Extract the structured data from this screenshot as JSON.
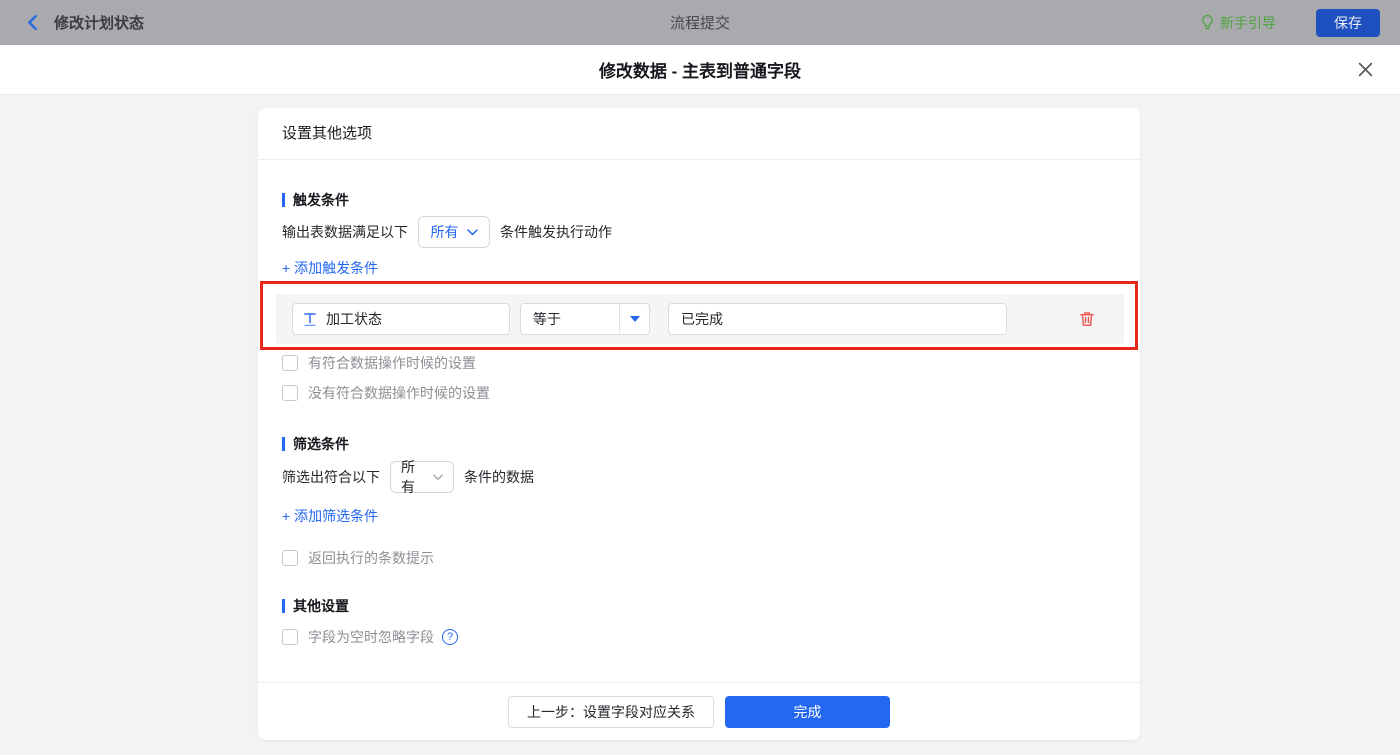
{
  "colors": {
    "accent_blue": "#2468f2",
    "highlight_red": "#e8271c",
    "guide_green": "#52a342",
    "danger_red": "#f2564f",
    "topbar_gray": "#a9aaad"
  },
  "topbar": {
    "back_label": "修改计划状态",
    "center_title": "流程提交",
    "guide_label": "新手引导",
    "save_label": "保存"
  },
  "modal": {
    "title": "修改数据 - 主表到普通字段",
    "card": {
      "header": "设置其他选项",
      "trigger": {
        "title": "触发条件",
        "prefix": "输出表数据满足以下",
        "select_value": "所有",
        "suffix": "条件触发执行动作",
        "add_link": "+ 添加触发条件",
        "condition": {
          "field": "加工状态",
          "operator": "等于",
          "value": "已完成"
        },
        "checkbox_with": "有符合数据操作时候的设置",
        "checkbox_without": "没有符合数据操作时候的设置"
      },
      "filter": {
        "title": "筛选条件",
        "prefix": "筛选出符合以下",
        "select_value": "所有",
        "suffix": "条件的数据",
        "add_link": "+ 添加筛选条件",
        "checkbox_count": "返回执行的条数提示"
      },
      "other": {
        "title": "其他设置",
        "checkbox_empty": "字段为空时忽略字段",
        "help_glyph": "?"
      },
      "footer": {
        "prev_label": "上一步：设置字段对应关系",
        "done_label": "完成"
      }
    }
  }
}
